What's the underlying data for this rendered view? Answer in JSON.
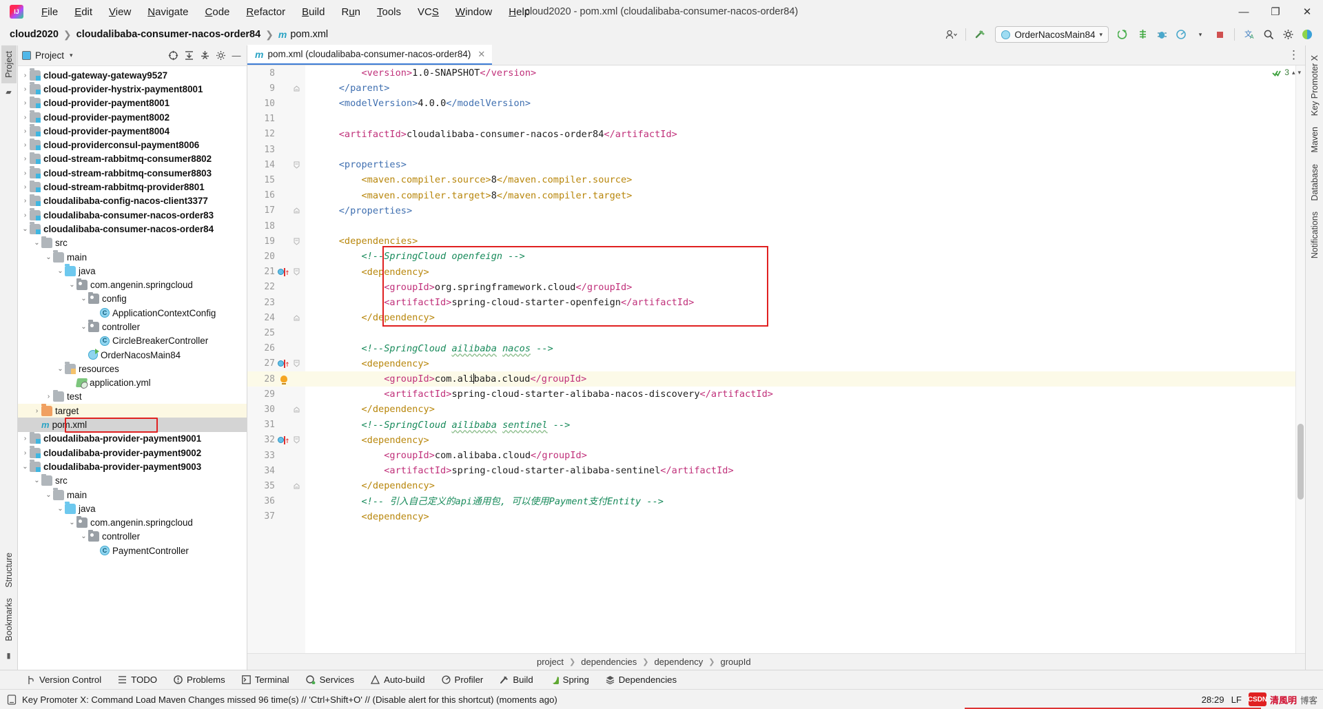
{
  "window": {
    "title": "cloud2020 - pom.xml (cloudalibaba-consumer-nacos-order84)",
    "minimize": "–",
    "maximize": "❐",
    "close": "✕"
  },
  "menu": [
    {
      "label": "File"
    },
    {
      "label": "Edit"
    },
    {
      "label": "View"
    },
    {
      "label": "Navigate"
    },
    {
      "label": "Code"
    },
    {
      "label": "Refactor"
    },
    {
      "label": "Build"
    },
    {
      "label": "Run"
    },
    {
      "label": "Tools"
    },
    {
      "label": "VCS"
    },
    {
      "label": "Window"
    },
    {
      "label": "Help"
    }
  ],
  "navbar": {
    "crumbs": [
      "cloud2020",
      "cloudalibaba-consumer-nacos-order84"
    ],
    "file": "pom.xml",
    "run_config": "OrderNacosMain84",
    "run_config_caret": "▾"
  },
  "left_strip": {
    "project_tab": "Project",
    "bookmarks_tab": "Bookmarks",
    "structure_tab": "Structure"
  },
  "right_strip": {
    "key_promoter_tab": "Key Promoter X",
    "maven_tab": "Maven",
    "database_tab": "Database",
    "notifications_tab": "Notifications"
  },
  "project_panel": {
    "title": "Project",
    "caret": "▾",
    "tree": [
      {
        "label": "cloud-gateway-gateway9527",
        "indent": 1,
        "arrow": "›",
        "icon": "module",
        "bold": true
      },
      {
        "label": "cloud-provider-hystrix-payment8001",
        "indent": 1,
        "arrow": "›",
        "icon": "module",
        "bold": true
      },
      {
        "label": "cloud-provider-payment8001",
        "indent": 1,
        "arrow": "›",
        "icon": "module",
        "bold": true
      },
      {
        "label": "cloud-provider-payment8002",
        "indent": 1,
        "arrow": "›",
        "icon": "module",
        "bold": true
      },
      {
        "label": "cloud-provider-payment8004",
        "indent": 1,
        "arrow": "›",
        "icon": "module",
        "bold": true
      },
      {
        "label": "cloud-providerconsul-payment8006",
        "indent": 1,
        "arrow": "›",
        "icon": "module",
        "bold": true
      },
      {
        "label": "cloud-stream-rabbitmq-consumer8802",
        "indent": 1,
        "arrow": "›",
        "icon": "module",
        "bold": true
      },
      {
        "label": "cloud-stream-rabbitmq-consumer8803",
        "indent": 1,
        "arrow": "›",
        "icon": "module",
        "bold": true
      },
      {
        "label": "cloud-stream-rabbitmq-provider8801",
        "indent": 1,
        "arrow": "›",
        "icon": "module",
        "bold": true
      },
      {
        "label": "cloudalibaba-config-nacos-client3377",
        "indent": 1,
        "arrow": "›",
        "icon": "module",
        "bold": true
      },
      {
        "label": "cloudalibaba-consumer-nacos-order83",
        "indent": 1,
        "arrow": "›",
        "icon": "module",
        "bold": true
      },
      {
        "label": "cloudalibaba-consumer-nacos-order84",
        "indent": 1,
        "arrow": "⌄",
        "icon": "module",
        "bold": true
      },
      {
        "label": "src",
        "indent": 2,
        "arrow": "⌄",
        "icon": "folder",
        "bold": false
      },
      {
        "label": "main",
        "indent": 3,
        "arrow": "⌄",
        "icon": "folder",
        "bold": false
      },
      {
        "label": "java",
        "indent": 4,
        "arrow": "⌄",
        "icon": "source",
        "bold": false
      },
      {
        "label": "com.angenin.springcloud",
        "indent": 5,
        "arrow": "⌄",
        "icon": "package",
        "bold": false
      },
      {
        "label": "config",
        "indent": 6,
        "arrow": "⌄",
        "icon": "package",
        "bold": false
      },
      {
        "label": "ApplicationContextConfig",
        "indent": 7,
        "arrow": "",
        "icon": "class",
        "bold": false
      },
      {
        "label": "controller",
        "indent": 6,
        "arrow": "⌄",
        "icon": "package",
        "bold": false
      },
      {
        "label": "CircleBreakerController",
        "indent": 7,
        "arrow": "",
        "icon": "class",
        "bold": false
      },
      {
        "label": "OrderNacosMain84",
        "indent": 6,
        "arrow": "",
        "icon": "runclass",
        "bold": false
      },
      {
        "label": "resources",
        "indent": 4,
        "arrow": "⌄",
        "icon": "resources",
        "bold": false
      },
      {
        "label": "application.yml",
        "indent": 5,
        "arrow": "",
        "icon": "yml",
        "bold": false
      },
      {
        "label": "test",
        "indent": 3,
        "arrow": "›",
        "icon": "folder",
        "bold": false
      },
      {
        "label": "target",
        "indent": 2,
        "arrow": "›",
        "icon": "target",
        "bold": false,
        "highlight": true
      },
      {
        "label": "pom.xml",
        "indent": 2,
        "arrow": "",
        "icon": "maven",
        "bold": false,
        "selected": true,
        "boxed": true
      },
      {
        "label": "cloudalibaba-provider-payment9001",
        "indent": 1,
        "arrow": "›",
        "icon": "module",
        "bold": true
      },
      {
        "label": "cloudalibaba-provider-payment9002",
        "indent": 1,
        "arrow": "›",
        "icon": "module",
        "bold": true
      },
      {
        "label": "cloudalibaba-provider-payment9003",
        "indent": 1,
        "arrow": "⌄",
        "icon": "module",
        "bold": true
      },
      {
        "label": "src",
        "indent": 2,
        "arrow": "⌄",
        "icon": "folder",
        "bold": false
      },
      {
        "label": "main",
        "indent": 3,
        "arrow": "⌄",
        "icon": "folder",
        "bold": false
      },
      {
        "label": "java",
        "indent": 4,
        "arrow": "⌄",
        "icon": "source",
        "bold": false
      },
      {
        "label": "com.angenin.springcloud",
        "indent": 5,
        "arrow": "⌄",
        "icon": "package",
        "bold": false
      },
      {
        "label": "controller",
        "indent": 6,
        "arrow": "⌄",
        "icon": "package",
        "bold": false
      },
      {
        "label": "PaymentController",
        "indent": 7,
        "arrow": "",
        "icon": "class",
        "bold": false
      }
    ]
  },
  "editor": {
    "tab_label": "pom.xml (cloudalibaba-consumer-nacos-order84)",
    "tab_close": "✕",
    "inspection_count": "3",
    "lines": [
      {
        "num": "8",
        "text": "        <version>1.0-SNAPSHOT</version>"
      },
      {
        "num": "9",
        "text": "    </parent>",
        "fold": "end"
      },
      {
        "num": "10",
        "text": "    <modelVersion>4.0.0</modelVersion>"
      },
      {
        "num": "11",
        "text": ""
      },
      {
        "num": "12",
        "text": "    <artifactId>cloudalibaba-consumer-nacos-order84</artifactId>"
      },
      {
        "num": "13",
        "text": ""
      },
      {
        "num": "14",
        "text": "    <properties>",
        "fold": "start"
      },
      {
        "num": "15",
        "text": "        <maven.compiler.source>8</maven.compiler.source>"
      },
      {
        "num": "16",
        "text": "        <maven.compiler.target>8</maven.compiler.target>"
      },
      {
        "num": "17",
        "text": "    </properties>",
        "fold": "end"
      },
      {
        "num": "18",
        "text": ""
      },
      {
        "num": "19",
        "text": "    <dependencies>",
        "fold": "start"
      },
      {
        "num": "20",
        "text": "        <!--SpringCloud openfeign -->"
      },
      {
        "num": "21",
        "text": "        <dependency>",
        "fold": "start",
        "marker": "bookmark"
      },
      {
        "num": "22",
        "text": "            <groupId>org.springframework.cloud</groupId>"
      },
      {
        "num": "23",
        "text": "            <artifactId>spring-cloud-starter-openfeign</artifactId>"
      },
      {
        "num": "24",
        "text": "        </dependency>",
        "fold": "end"
      },
      {
        "num": "25",
        "text": ""
      },
      {
        "num": "26",
        "text": "        <!--SpringCloud ailibaba nacos -->"
      },
      {
        "num": "27",
        "text": "        <dependency>",
        "fold": "start",
        "marker": "bookmark"
      },
      {
        "num": "28",
        "text": "            <groupId>com.alibaba.cloud</groupId>",
        "marker": "bulb",
        "current": true
      },
      {
        "num": "29",
        "text": "            <artifactId>spring-cloud-starter-alibaba-nacos-discovery</artifactId>"
      },
      {
        "num": "30",
        "text": "        </dependency>",
        "fold": "end"
      },
      {
        "num": "31",
        "text": "        <!--SpringCloud ailibaba sentinel -->"
      },
      {
        "num": "32",
        "text": "        <dependency>",
        "fold": "start",
        "marker": "bookmark"
      },
      {
        "num": "33",
        "text": "            <groupId>com.alibaba.cloud</groupId>"
      },
      {
        "num": "34",
        "text": "            <artifactId>spring-cloud-starter-alibaba-sentinel</artifactId>"
      },
      {
        "num": "35",
        "text": "        </dependency>",
        "fold": "end"
      },
      {
        "num": "36",
        "text": "        <!-- 引入自己定义的api通用包, 可以使用Payment支付Entity -->"
      },
      {
        "num": "37",
        "text": "        <dependency>"
      }
    ]
  },
  "breadcrumb_bottom": [
    "project",
    "dependencies",
    "dependency",
    "groupId"
  ],
  "bottom_tools": [
    {
      "label": "Version Control",
      "icon": "branch-icon"
    },
    {
      "label": "TODO",
      "icon": "list-icon"
    },
    {
      "label": "Problems",
      "icon": "error-icon"
    },
    {
      "label": "Terminal",
      "icon": "terminal-icon"
    },
    {
      "label": "Services",
      "icon": "services-icon"
    },
    {
      "label": "Auto-build",
      "icon": "hammer-icon"
    },
    {
      "label": "Profiler",
      "icon": "profiler-icon"
    },
    {
      "label": "Build",
      "icon": "build-icon"
    },
    {
      "label": "Spring",
      "icon": "spring-icon"
    },
    {
      "label": "Dependencies",
      "icon": "dependencies-icon"
    }
  ],
  "statusbar": {
    "message": "Key Promoter X: Command Load Maven Changes missed 96 time(s) // 'Ctrl+Shift+O' // (Disable alert for this shortcut) (moments ago)",
    "caret_position": "28:29",
    "line_sep": "LF",
    "watermark_cn": "清風明",
    "watermark_cn2": "博客",
    "csdn": "CSDN"
  },
  "colors": {
    "accent_blue": "#3d7dd6",
    "red_highlight": "#e02020",
    "tag": "#3f6fb0",
    "tag_alt": "#b8860b",
    "attr": "#c0307a",
    "comment": "#178a5a",
    "gutter_bg": "#f7f7f7",
    "current_line": "#fcfae8"
  }
}
